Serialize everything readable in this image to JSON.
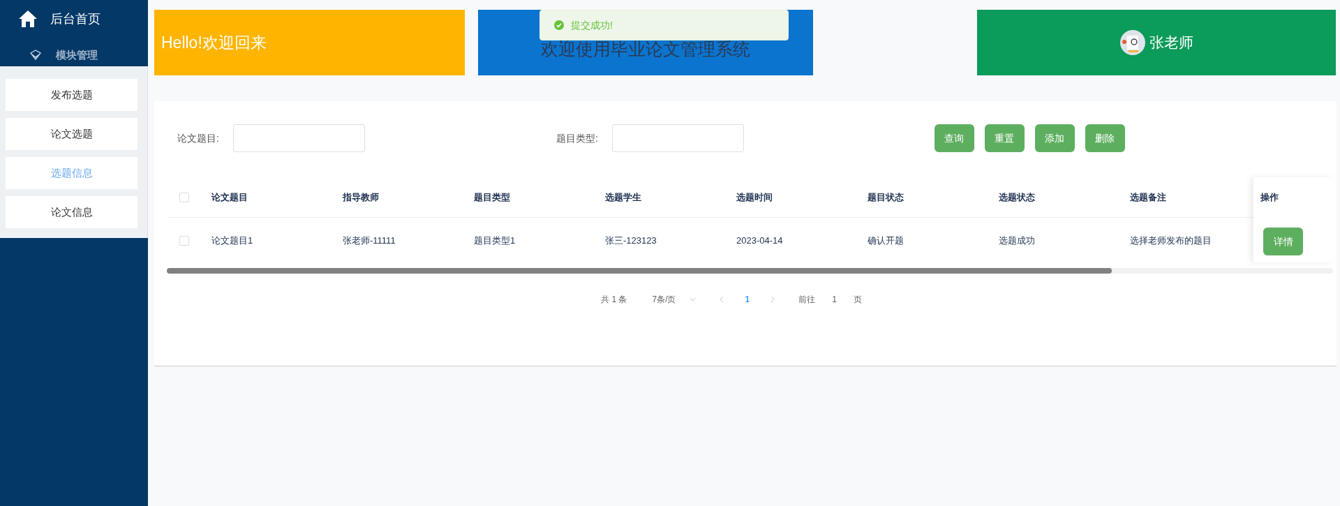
{
  "sidebar": {
    "home": {
      "label": "后台首页"
    },
    "group": {
      "label": "模块管理"
    },
    "items": [
      {
        "label": "发布选题",
        "selected": false
      },
      {
        "label": "论文选题",
        "selected": false
      },
      {
        "label": "选题信息",
        "selected": true
      },
      {
        "label": "论文信息",
        "selected": false
      }
    ]
  },
  "banners": [
    {
      "kind": "greeting",
      "text": "Hello!欢迎回来"
    },
    {
      "kind": "title",
      "text": "欢迎使用毕业论文管理系统"
    },
    {
      "kind": "user",
      "text": "张老师"
    }
  ],
  "toast": {
    "text": "提交成功!"
  },
  "filters": [
    {
      "label": "论文题目:"
    },
    {
      "label": "题目类型:"
    }
  ],
  "buttons": [
    "查询",
    "重置",
    "添加",
    "删除"
  ],
  "table": {
    "select_all": {
      "checked": false
    },
    "columns": [
      "论文题目",
      "指导教师",
      "题目类型",
      "选题学生",
      "选题时间",
      "题目状态",
      "选题状态",
      "选题备注",
      "操作"
    ],
    "rows": [
      {
        "checked": false,
        "cells": [
          "论文题目1",
          "张老师-11111",
          "题目类型1",
          "张三-123123",
          "2023-04-14",
          "确认开题",
          "选题成功",
          "选择老师发布的题目"
        ],
        "action": "详情"
      }
    ]
  },
  "scrollbar": {
    "level": 0.81
  },
  "pagination": {
    "total": "共 1 条",
    "page_size": "7条/页",
    "current": "1",
    "goto_label": "前往",
    "goto_value": "1",
    "goto_suffix": "页"
  }
}
